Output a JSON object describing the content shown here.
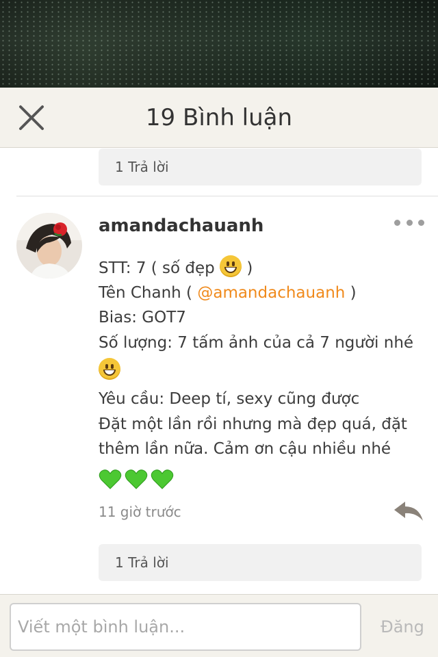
{
  "header": {
    "title": "19 Bình luận",
    "close_icon": "close-icon"
  },
  "previous_comment": {
    "replies_label": "1 Trả lời"
  },
  "comment": {
    "username": "amandachauanh",
    "avatar_icon": "user-avatar",
    "line1_prefix": "STT: 7 ( số đẹp",
    "line1_suffix": ")",
    "line2_prefix": "Tên Chanh (",
    "line2_mention": "@amandachauanh",
    "line2_suffix": ")",
    "line3": "Bias: GOT7",
    "line4": "Số lượng: 7 tấm ảnh của cả 7 người nhé",
    "line6": "Yêu cầu: Deep tí, sexy cũng được",
    "line7": "Đặt một lần rồi nhưng mà đẹp quá, đặt",
    "line8": "thêm lần nữa. Cảm ơn cậu nhiều nhé",
    "emoji": "grinning-face-emoji",
    "hearts": [
      "green-heart-emoji",
      "green-heart-emoji",
      "green-heart-emoji"
    ],
    "timestamp": "11 giờ trước",
    "replies_label": "1 Trả lời",
    "more_icon": "more-dots-icon",
    "reply_icon": "reply-arrow-icon"
  },
  "footer": {
    "input_placeholder": "Viết một bình luận...",
    "input_value": "",
    "post_label": "Đăng"
  },
  "colors": {
    "accent": "#f08a1c",
    "header_bg": "#f4f2ec",
    "heart": "#4cc832"
  }
}
